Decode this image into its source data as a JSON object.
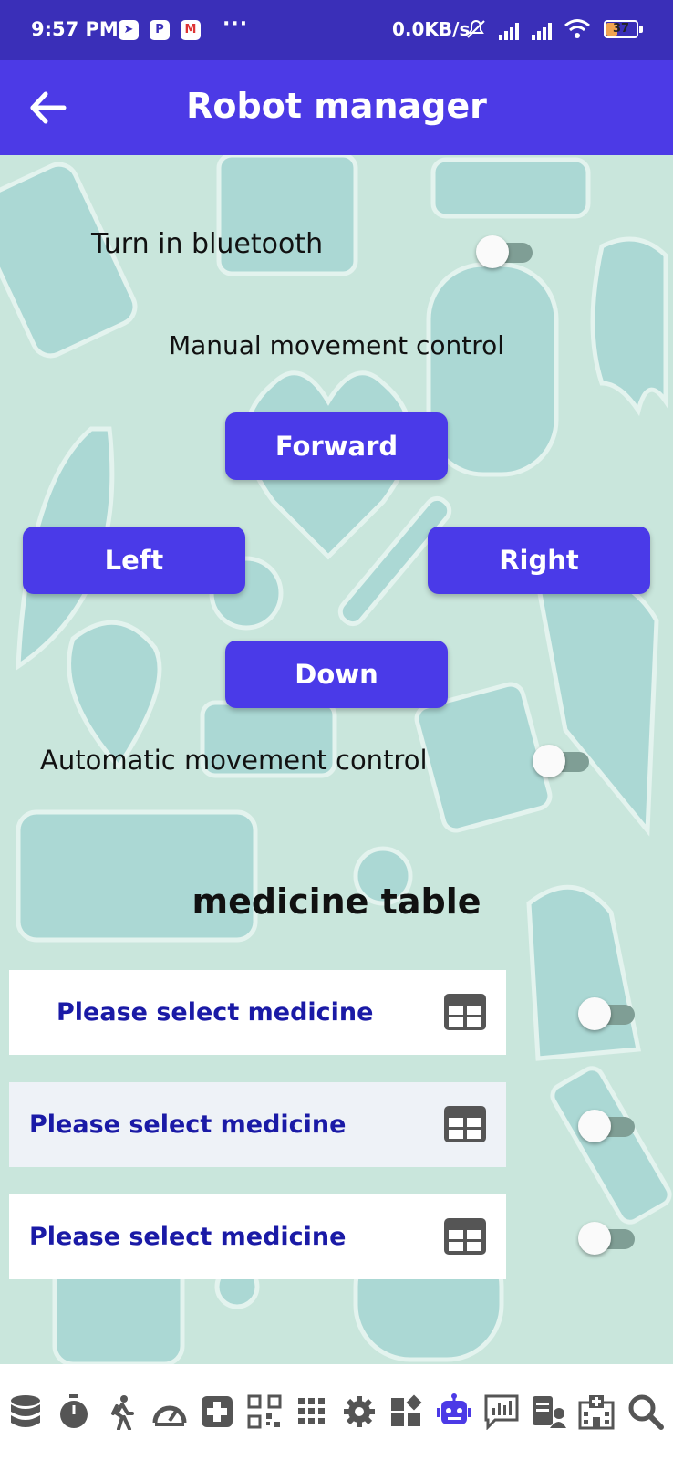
{
  "status_bar": {
    "time": "9:57 PM",
    "net_speed": "0.0KB/s",
    "battery": "37",
    "battery_level_percent": 37,
    "notification_icons": [
      "telegram-icon",
      "p-app-icon",
      "gmail-icon"
    ],
    "more": "···"
  },
  "app_bar": {
    "title": "Robot manager",
    "back_icon": "arrow-left-icon"
  },
  "bluetooth": {
    "label": "Turn in bluetooth",
    "on": false
  },
  "manual": {
    "title": "Manual movement control",
    "forward": "Forward",
    "left": "Left",
    "right": "Right",
    "down": "Down"
  },
  "automatic": {
    "label": "Automatic movement control",
    "on": false
  },
  "medicine_table": {
    "title": "medicine table",
    "rows": [
      {
        "placeholder": "Please select medicine",
        "on": false
      },
      {
        "placeholder": "Please select medicine",
        "on": false
      },
      {
        "placeholder": "Please select medicine",
        "on": false
      }
    ]
  },
  "bottom_nav": {
    "items": [
      "database-icon",
      "timer-icon",
      "walking-icon",
      "gauge-icon",
      "medical-cross-icon",
      "qr-code-icon",
      "apps-grid-icon",
      "settings-gear-icon",
      "widgets-icon",
      "robot-icon",
      "chart-message-icon",
      "patient-record-icon",
      "hospital-icon",
      "search-icon"
    ],
    "active": "robot-icon"
  },
  "colors": {
    "primary": "#4c3ae6",
    "status_bar": "#3a2fb8",
    "background": "#c9e6dc",
    "medicine_text": "#1a1aa6",
    "toggle_track": "#7f9e95"
  }
}
